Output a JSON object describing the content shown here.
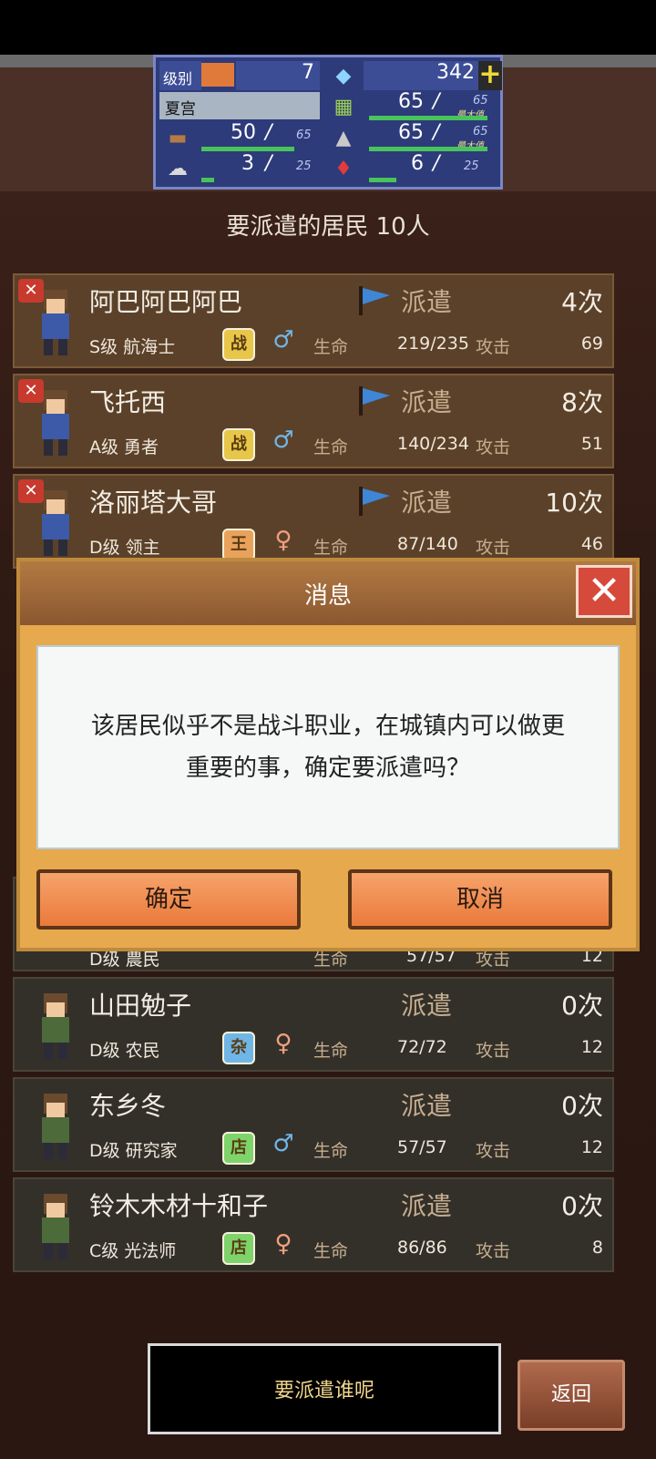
{
  "stats": {
    "level_label": "级别",
    "level": "7",
    "gems": "342",
    "plus": "+",
    "town": "夏宫",
    "food_current": "65",
    "food_max": "65",
    "food_max_tag": "最大值",
    "wood_current": "50",
    "wood_max": "65",
    "material_current": "65",
    "material_max": "65",
    "material_max_tag": "最大值",
    "ore_current": "3",
    "ore_max": "25",
    "ruby_current": "6",
    "ruby_max": "25",
    "separator": "/"
  },
  "subtitle": "要派遣的居民 10人",
  "residents": [
    {
      "name": "阿巴阿巴阿巴",
      "dispatch": "派遣",
      "count": "4次",
      "rank": "S级 航海士",
      "job": "战",
      "job_color": "#e7c64a",
      "gender": "male",
      "life_label": "生命",
      "life": "219/235",
      "atk_label": "攻击",
      "atk": "69",
      "selected": true
    },
    {
      "name": "飞托西",
      "dispatch": "派遣",
      "count": "8次",
      "rank": "A级 勇者",
      "job": "战",
      "job_color": "#e7c64a",
      "gender": "male",
      "life_label": "生命",
      "life": "140/234",
      "atk_label": "攻击",
      "atk": "51",
      "selected": true
    },
    {
      "name": "洛丽塔大哥",
      "dispatch": "派遣",
      "count": "10次",
      "rank": "D级 领主",
      "job": "王",
      "job_color": "#e8a25c",
      "gender": "female",
      "life_label": "生命",
      "life": "87/140",
      "atk_label": "攻击",
      "atk": "46",
      "selected": true
    },
    {
      "name": "山田勉子",
      "dispatch": "派遣",
      "count": "0次",
      "rank": "D级 农民",
      "job": "杂",
      "job_color": "#6fb6e6",
      "gender": "female",
      "life_label": "生命",
      "life": "72/72",
      "atk_label": "攻击",
      "atk": "12",
      "selected": false
    },
    {
      "name": "东乡冬",
      "dispatch": "派遣",
      "count": "0次",
      "rank": "D级 研究家",
      "job": "店",
      "job_color": "#7ed36a",
      "gender": "male",
      "life_label": "生命",
      "life": "57/57",
      "atk_label": "攻击",
      "atk": "12",
      "selected": false
    },
    {
      "name": "铃木木材十和子",
      "dispatch": "派遣",
      "count": "0次",
      "rank": "C级 光法师",
      "job": "店",
      "job_color": "#7ed36a",
      "gender": "female",
      "life_label": "生命",
      "life": "86/86",
      "atk_label": "攻击",
      "atk": "8",
      "selected": false
    }
  ],
  "hidden_row": {
    "rank": "D级 農民",
    "life_label": "生命",
    "life": "57/57",
    "atk_label": "攻击",
    "atk": "12"
  },
  "dialog": {
    "title": "消息",
    "close": "✕",
    "message": "该居民似乎不是战斗职业，在城镇内可以做更重要的事，确定要派遣吗？",
    "confirm": "确定",
    "cancel": "取消"
  },
  "footer": {
    "prompt": "要派遣谁呢",
    "back": "返回"
  },
  "colors": {
    "card_selected": "#5b4129",
    "card_default": "#33302a",
    "dialog": "#e6a94e",
    "button": "#ea7a3c",
    "panel": "#2d3b7a"
  }
}
